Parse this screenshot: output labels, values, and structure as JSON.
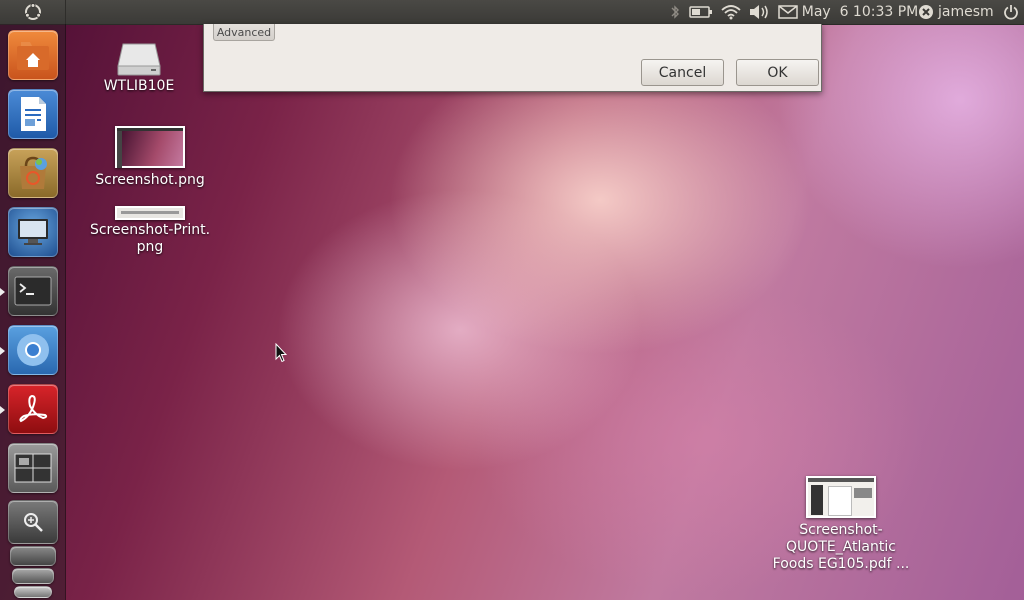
{
  "top_panel": {
    "clock": "May  6 10:33 PM",
    "user": "jamesm",
    "icons": [
      "ubuntu-logo-icon",
      "bluetooth-icon",
      "battery-icon",
      "wifi-icon",
      "volume-icon",
      "mail-icon",
      "user-status-icon",
      "power-icon"
    ]
  },
  "launcher": {
    "items": [
      {
        "name": "home-folder",
        "icon": "home-folder-icon"
      },
      {
        "name": "libreoffice-writer",
        "icon": "writer-icon"
      },
      {
        "name": "ubuntu-software-center",
        "icon": "software-center-icon"
      },
      {
        "name": "remote-desktop",
        "icon": "monitor-icon"
      },
      {
        "name": "terminal",
        "icon": "terminal-icon"
      },
      {
        "name": "chromium",
        "icon": "chromium-icon"
      },
      {
        "name": "adobe-reader",
        "icon": "adobe-reader-icon"
      },
      {
        "name": "workspace-switcher",
        "icon": "workspaces-icon"
      },
      {
        "name": "screen-magnifier",
        "icon": "magnifier-icon"
      }
    ]
  },
  "dialog": {
    "advanced_label": "Advanced",
    "cancel_label": "Cancel",
    "ok_label": "OK"
  },
  "desktop": {
    "icons": [
      {
        "label": "WTLIB10E"
      },
      {
        "label": "Screenshot.png"
      },
      {
        "label_line1": "Screenshot-Print.",
        "label_line2": "png"
      },
      {
        "label_line1": "Screenshot-",
        "label_line2": "QUOTE_Atlantic",
        "label_line3": "Foods EG105.pdf ..."
      }
    ]
  },
  "colors": {
    "panel": "#3c3b37",
    "dialog": "#efebe7",
    "wallpaper_dark": "#4a0d33",
    "wallpaper_light": "#f6d8d3"
  }
}
